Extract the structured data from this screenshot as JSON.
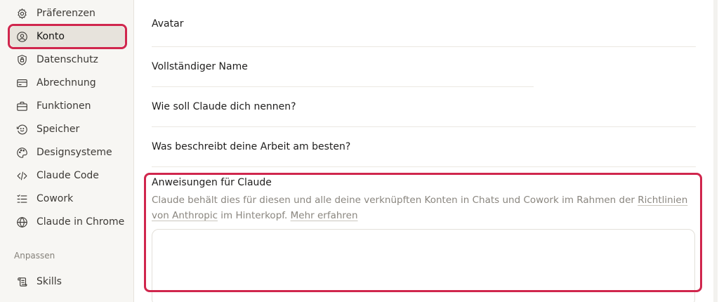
{
  "sidebar": {
    "items": [
      {
        "label": "Präferenzen",
        "icon": "gear-icon"
      },
      {
        "label": "Konto",
        "icon": "user-circle-icon",
        "active": true
      },
      {
        "label": "Datenschutz",
        "icon": "shield-icon"
      },
      {
        "label": "Abrechnung",
        "icon": "credit-card-icon"
      },
      {
        "label": "Funktionen",
        "icon": "briefcase-icon"
      },
      {
        "label": "Speicher",
        "icon": "memory-face-icon"
      },
      {
        "label": "Designsysteme",
        "icon": "palette-icon"
      },
      {
        "label": "Claude Code",
        "icon": "code-icon"
      },
      {
        "label": "Cowork",
        "icon": "checklist-icon"
      },
      {
        "label": "Claude in Chrome",
        "icon": "globe-icon"
      }
    ],
    "section_label": "Anpassen",
    "section_items": [
      {
        "label": "Skills",
        "icon": "scroll-icon"
      }
    ]
  },
  "main": {
    "avatar_label": "Avatar",
    "full_name_label": "Vollständiger Name",
    "nickname_label": "Wie soll Claude dich nennen?",
    "work_label": "Was beschreibt deine Arbeit am besten?",
    "instructions": {
      "title": "Anweisungen für Claude",
      "desc_prefix": "Claude behält dies für diesen und alle deine verknüpften Konten in Chats und Cowork im Rahmen der ",
      "link_guidelines": "Richtlinien von Anthropic",
      "desc_middle": " im Hinterkopf. ",
      "link_more": "Mehr erfahren",
      "value": ""
    }
  },
  "colors": {
    "highlight": "#d0264d",
    "sidebar_bg": "#f7f6f3",
    "active_bg": "#e7e3dc"
  }
}
